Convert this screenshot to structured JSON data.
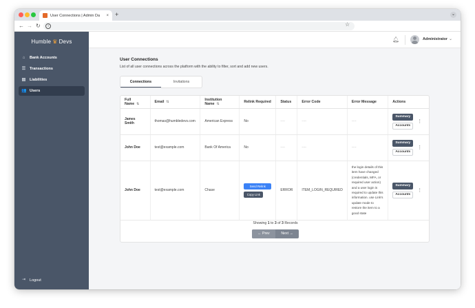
{
  "browser": {
    "tab_title": "User Connections | Admin Da",
    "tab_close": "×",
    "new_tab": "+",
    "traffic_colors": [
      "#ff5f57",
      "#febc2e",
      "#28c840"
    ]
  },
  "sidebar": {
    "brand_left": "Humble",
    "brand_right": "Devs",
    "items": [
      {
        "label": "Bank Accounts",
        "icon": "bank-icon"
      },
      {
        "label": "Transactions",
        "icon": "list-icon"
      },
      {
        "label": "Liabilities",
        "icon": "document-icon"
      },
      {
        "label": "Users",
        "icon": "users-icon",
        "active": true
      }
    ],
    "logout": "Logout"
  },
  "header": {
    "user": "Administrator"
  },
  "page": {
    "title": "User Connections",
    "subtitle": "List of all user connections across the platform with the ability to filter, sort and add new users.",
    "tabs": [
      "Connections",
      "Invitations"
    ],
    "active_tab": "Connections"
  },
  "table": {
    "columns": [
      "Full Name",
      "Email",
      "Institution Name",
      "Relink Required",
      "Status",
      "Error Code",
      "Error Message",
      "Actions"
    ],
    "rows": [
      {
        "full_name": "James Smith",
        "email": "thomas@humbledevs.com",
        "institution": "American Express",
        "relink": "No",
        "status": "----",
        "error_code": "----",
        "error_message": "----"
      },
      {
        "full_name": "John Doe",
        "email": "test@example.com",
        "institution": "Bank Of America",
        "relink": "No",
        "status": "----",
        "error_code": "----",
        "error_message": "----"
      },
      {
        "full_name": "John Doe",
        "email": "test@example.com",
        "institution": "Chase",
        "relink_primary": "Send Relink",
        "relink_secondary": "Copy Link",
        "status": "ERROR",
        "error_code": "ITEM_LOGIN_REQUIRED",
        "error_message": "the login details of this item have changed (credentials, MFA, or required user action) and a user login is required to update this information. use Link's update mode to restore the item to a good state"
      }
    ],
    "summary_label": "Summary",
    "accounts_label": "Accounts",
    "kebab": "⋮"
  },
  "pagination": {
    "showing": "Showing",
    "from": "1",
    "to_word": "to",
    "to": "3",
    "of_word": "of",
    "total": "3",
    "records": "Records",
    "prev": "Prev",
    "next": "Next"
  }
}
